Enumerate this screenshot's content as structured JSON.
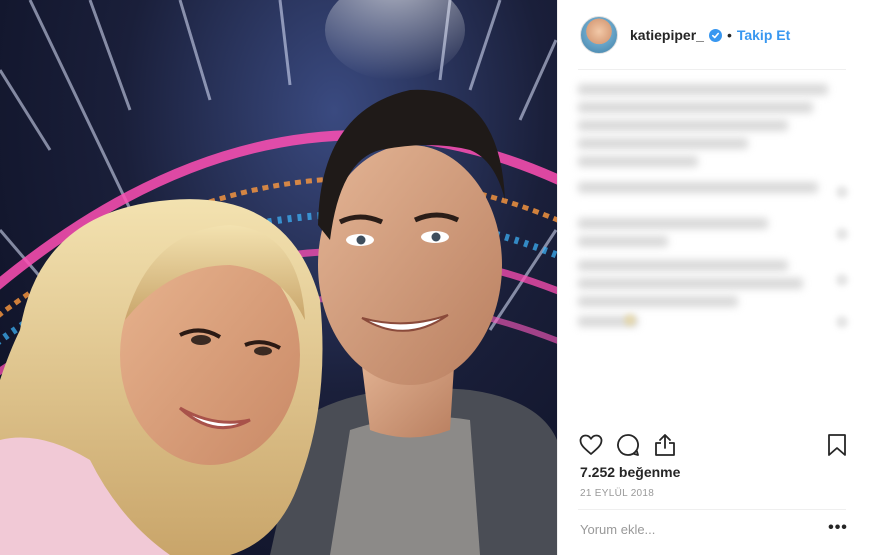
{
  "post": {
    "username": "katiepiper_",
    "separator": "•",
    "follow_label": "Takip Et",
    "likes_text": "7.252 beğenme",
    "date_text": "21 EYLÜL 2018",
    "comment_placeholder": "Yorum ekle...",
    "more_label": "•••"
  },
  "icons": {
    "verified": "verified-badge-icon",
    "like": "heart-icon",
    "comment": "comment-bubble-icon",
    "share": "share-icon",
    "save": "bookmark-icon",
    "more": "more-options-icon"
  },
  "colors": {
    "accent": "#3897f0",
    "text": "#262626",
    "muted": "#999999",
    "divider": "#efefef"
  },
  "photo": {
    "description_icon": "selfie-photo"
  }
}
